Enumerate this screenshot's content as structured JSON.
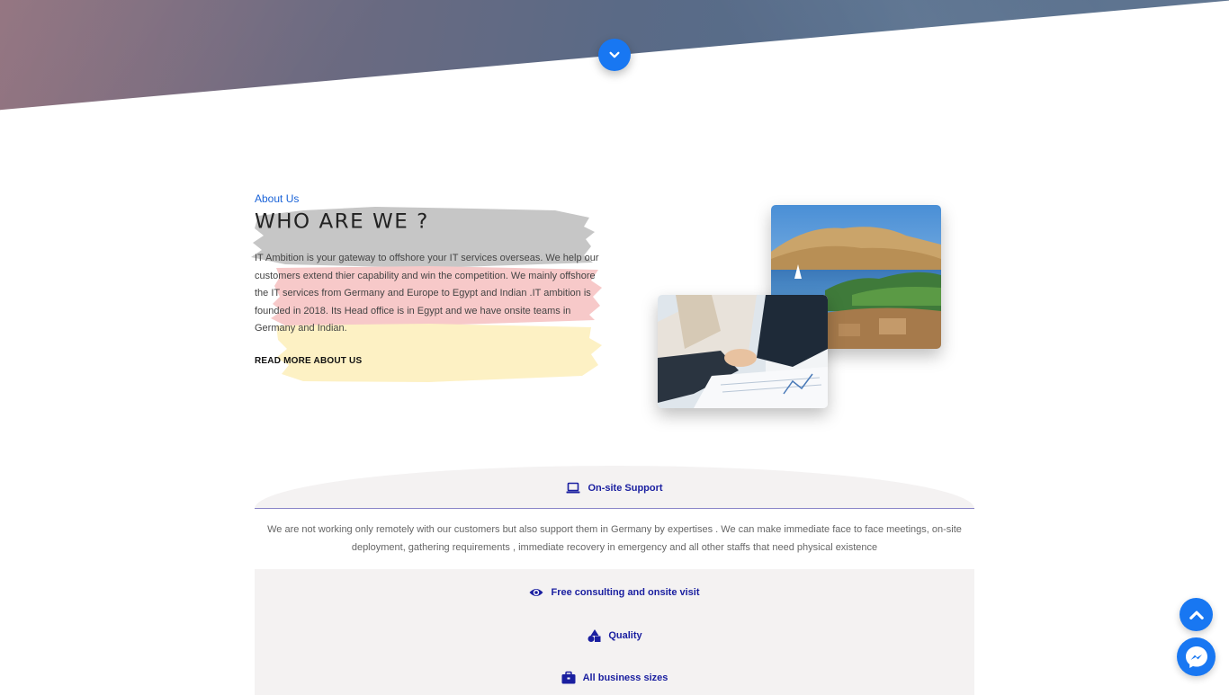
{
  "colors": {
    "accent": "#1877f2",
    "feature_text": "#1a1fa0",
    "label_blue": "#1a63d8",
    "panel_bg": "#f4f2f2"
  },
  "hero": {
    "scroll_icon": "chevron-down-icon"
  },
  "about": {
    "label": "About Us",
    "title": "WHO ARE WE ?",
    "paragraph": "IT Ambition is your gateway to offshore your IT services overseas. We help our customers extend thier capability and win the competition. We mainly offshore the IT services from Germany and Europe to Egypt and Indian .IT ambition is founded in 2018. Its Head office is in Egypt and we have onsite teams in Germany and Indian.",
    "read_more": "READ MORE ABOUT US"
  },
  "features": {
    "onsite": {
      "title": "On-site Support",
      "icon": "laptop-icon",
      "text": "We are not working only remotely with our customers but also support them in Germany by expertises . We can make immediate face to face meetings, on-site deployment, gathering requirements , immediate recovery in emergency and all other staffs that need physical existence"
    },
    "items": [
      {
        "title": "Free consulting and onsite visit",
        "icon": "eye-icon"
      },
      {
        "title": "Quality",
        "icon": "shapes-icon"
      },
      {
        "title": "All business sizes",
        "icon": "briefcase-icon"
      }
    ]
  },
  "floating": {
    "scroll_top_icon": "chevron-up-icon",
    "messenger_icon": "messenger-icon"
  }
}
